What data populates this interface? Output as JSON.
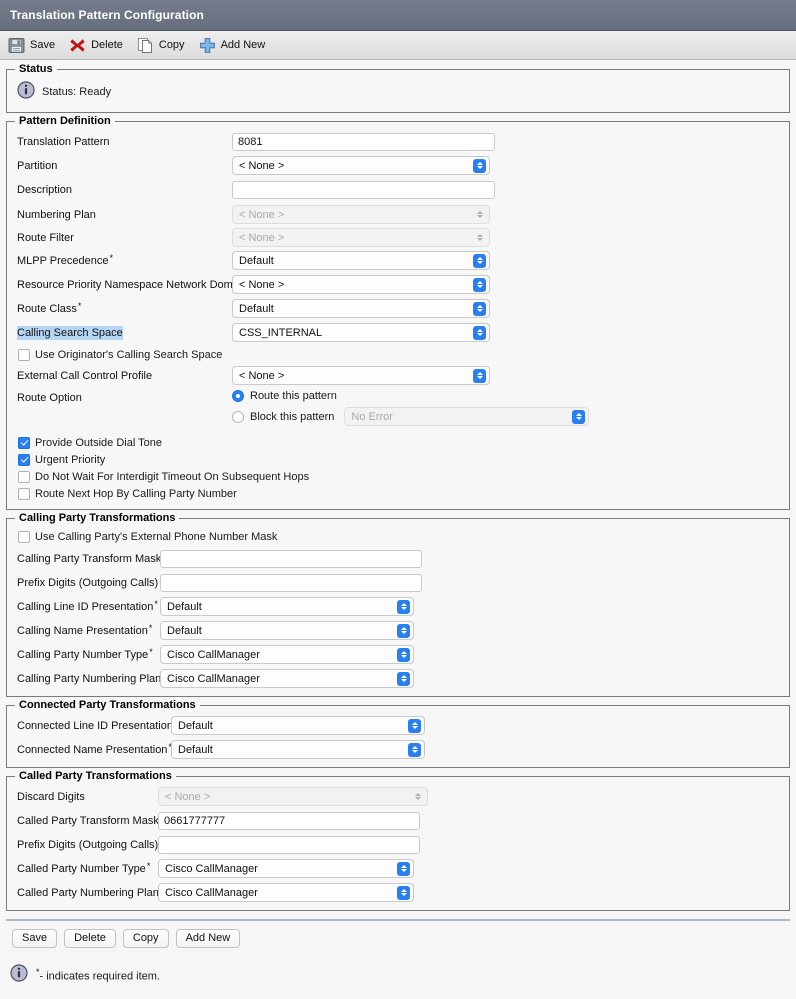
{
  "window": {
    "title": "Translation Pattern Configuration"
  },
  "toolbar": {
    "items": [
      {
        "label": "Save",
        "icon": "save-floppy-icon"
      },
      {
        "label": "Delete",
        "icon": "delete-x-icon"
      },
      {
        "label": "Copy",
        "icon": "copy-page-icon"
      },
      {
        "label": "Add New",
        "icon": "add-plus-icon"
      }
    ]
  },
  "status": {
    "legend": "Status",
    "icon": "info-icon",
    "text": "Status: Ready"
  },
  "pattern_definition": {
    "legend": "Pattern Definition",
    "translation_pattern": {
      "label": "Translation Pattern",
      "value": "8081"
    },
    "partition": {
      "label": "Partition",
      "value": "< None >"
    },
    "description": {
      "label": "Description",
      "value": ""
    },
    "numbering_plan": {
      "label": "Numbering Plan",
      "value": "< None >"
    },
    "route_filter": {
      "label": "Route Filter",
      "value": "< None >"
    },
    "mlpp_precedence": {
      "label": "MLPP Precedence",
      "value": "Default"
    },
    "resource_priority": {
      "label": "Resource Priority Namespace Network Domain",
      "value": "< None >"
    },
    "route_class": {
      "label": "Route Class",
      "value": "Default"
    },
    "calling_search_space": {
      "label": "Calling Search Space",
      "value": "CSS_INTERNAL"
    },
    "use_originators_css": {
      "label": "Use Originator's Calling Search Space"
    },
    "external_call_control_profile": {
      "label": "External Call Control Profile",
      "value": "< None >"
    },
    "route_option": {
      "label": "Route Option",
      "route_this_pattern": "Route this pattern",
      "block_this_pattern": "Block this pattern",
      "block_reason": "No Error"
    },
    "checkboxes": [
      {
        "label": "Provide Outside Dial Tone"
      },
      {
        "label": "Urgent Priority"
      },
      {
        "label": "Do Not Wait For Interdigit Timeout On Subsequent Hops"
      },
      {
        "label": "Route Next Hop By Calling Party Number"
      }
    ]
  },
  "calling_party_transformations": {
    "legend": "Calling Party Transformations",
    "use_external_mask": {
      "label": "Use Calling Party's External Phone Number Mask"
    },
    "transform_mask": {
      "label": "Calling Party Transform Mask",
      "value": ""
    },
    "prefix_digits": {
      "label": "Prefix Digits (Outgoing Calls)",
      "value": ""
    },
    "line_id_presentation": {
      "label": "Calling Line ID Presentation",
      "value": "Default"
    },
    "name_presentation": {
      "label": "Calling Name Presentation",
      "value": "Default"
    },
    "number_type": {
      "label": "Calling Party Number Type",
      "value": "Cisco CallManager"
    },
    "numbering_plan": {
      "label": "Calling Party Numbering Plan",
      "value": "Cisco CallManager"
    }
  },
  "connected_party_transformations": {
    "legend": "Connected Party Transformations",
    "line_id_presentation": {
      "label": "Connected Line ID Presentation",
      "value": "Default"
    },
    "name_presentation": {
      "label": "Connected Name Presentation",
      "value": "Default"
    }
  },
  "called_party_transformations": {
    "legend": "Called Party Transformations",
    "discard_digits": {
      "label": "Discard Digits",
      "value": "< None >"
    },
    "transform_mask": {
      "label": "Called Party Transform Mask",
      "value": "0661777777"
    },
    "prefix_digits": {
      "label": "Prefix Digits (Outgoing Calls)",
      "value": ""
    },
    "number_type": {
      "label": "Called Party Number Type",
      "value": "Cisco CallManager"
    },
    "numbering_plan": {
      "label": "Called Party Numbering Plan",
      "value": "Cisco CallManager"
    }
  },
  "bottom_buttons": [
    {
      "label": "Save"
    },
    {
      "label": "Delete"
    },
    {
      "label": "Copy"
    },
    {
      "label": "Add New"
    }
  ],
  "footer": {
    "icon": "info-icon",
    "star": "*",
    "text": "- indicates required item."
  },
  "colors": {
    "titlebar": "#6b7384",
    "accent_blue": "#2a7ff0",
    "highlight": "#b6d4f4",
    "separator": "#a7bcc4",
    "delete_red": "#c01313"
  }
}
